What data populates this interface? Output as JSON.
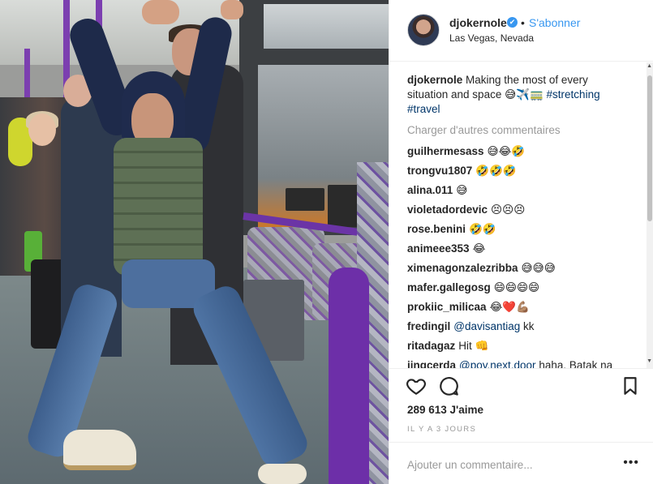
{
  "post": {
    "username": "djokernole",
    "verified_badge": "✔",
    "separator": "•",
    "follow_label": "S'abonner",
    "location": "Las Vegas, Nevada"
  },
  "caption": {
    "username": "djokernole",
    "text": "Making the most of every situation and space 😅✈️🚃",
    "hashtag1": "#stretching",
    "hashtag2": "#travel"
  },
  "load_more_label": "Charger d'autres commentaires",
  "comments": [
    {
      "user": "guilhermesass",
      "text": "😅😂🤣"
    },
    {
      "user": "trongvu1807",
      "text": "🤣🤣🤣"
    },
    {
      "user": "alina.011",
      "text": "😅"
    },
    {
      "user": "violetadordevic",
      "text": "😣😣😣"
    },
    {
      "user": "rose.benini",
      "text": "🤣🤣"
    },
    {
      "user": "animeee353",
      "text": "😂"
    },
    {
      "user": "ximenagonzalezribba",
      "text": "😅😅😅"
    },
    {
      "user": "mafer.gallegosg",
      "text": "😄😄😄😄"
    },
    {
      "user": "prokiic_milicaa",
      "text": "😂❤️💪🏽"
    },
    {
      "user": "fredingil",
      "mention": "@davisantiag",
      "text": "kk"
    },
    {
      "user": "ritadagaz",
      "text": "Hit 👊"
    },
    {
      "user": "jingcerda",
      "mention": "@poy.next.door",
      "text": "haha. Batak na"
    }
  ],
  "icons": {
    "like": "heart-icon",
    "comment": "comment-bubble-icon",
    "save": "bookmark-icon",
    "more": "ellipsis-icon"
  },
  "likes_text": "289 613 J'aime",
  "time_ago": "IL Y A 3 JOURS",
  "add_comment_placeholder": "Ajouter un commentaire...",
  "more_options": "•••",
  "colors": {
    "link_blue": "#3897f0",
    "hashtag_blue": "#003569",
    "muted_gray": "#999999",
    "text": "#262626"
  }
}
